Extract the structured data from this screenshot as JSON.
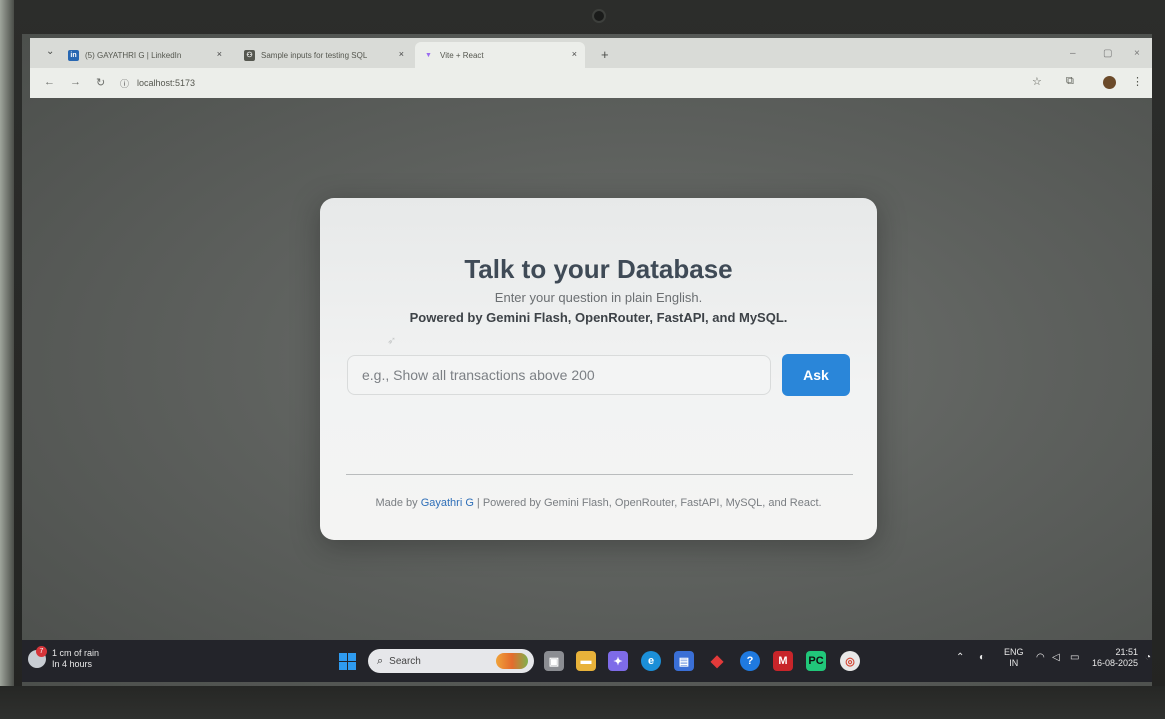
{
  "browser": {
    "tabs": [
      {
        "label": "(5) GAYATHRI G | LinkedIn",
        "icon": "linkedin-icon",
        "color": "#2867b2",
        "glyph": "in"
      },
      {
        "label": "Sample inputs for testing SQL",
        "icon": "chat-icon",
        "color": "#55574f",
        "glyph": "⚇"
      },
      {
        "label": "Vite + React",
        "icon": "vite-icon",
        "color": "#9a6cf0",
        "glyph": "▼"
      }
    ],
    "tab_close_glyph": "×",
    "new_tab_glyph": "+",
    "url": "localhost:5173",
    "window_controls": [
      "–",
      "▢",
      "×"
    ]
  },
  "card": {
    "title": "Talk to your Database",
    "subtitle": "Enter your question in plain English.",
    "powered_by": "Powered by Gemini Flash, OpenRouter, FastAPI, and MySQL.",
    "input_placeholder": "e.g., Show all transactions above 200",
    "input_value": "",
    "ask_label": "Ask",
    "footer_prefix": "Made by ",
    "footer_author": "Gayathri G",
    "footer_suffix": " | Powered by Gemini Flash, OpenRouter, FastAPI, MySQL, and React."
  },
  "taskbar": {
    "weather_line1": "1 cm of rain",
    "weather_line2": "In 4 hours",
    "weather_badge": "7",
    "search_label": "Search",
    "lang_line1": "ENG",
    "lang_line2": "IN",
    "time": "21:51",
    "date": "16-08-2025"
  },
  "colors": {
    "accent": "#2a86d9",
    "title": "#3f4a56",
    "author_link": "#2f6fb8"
  }
}
